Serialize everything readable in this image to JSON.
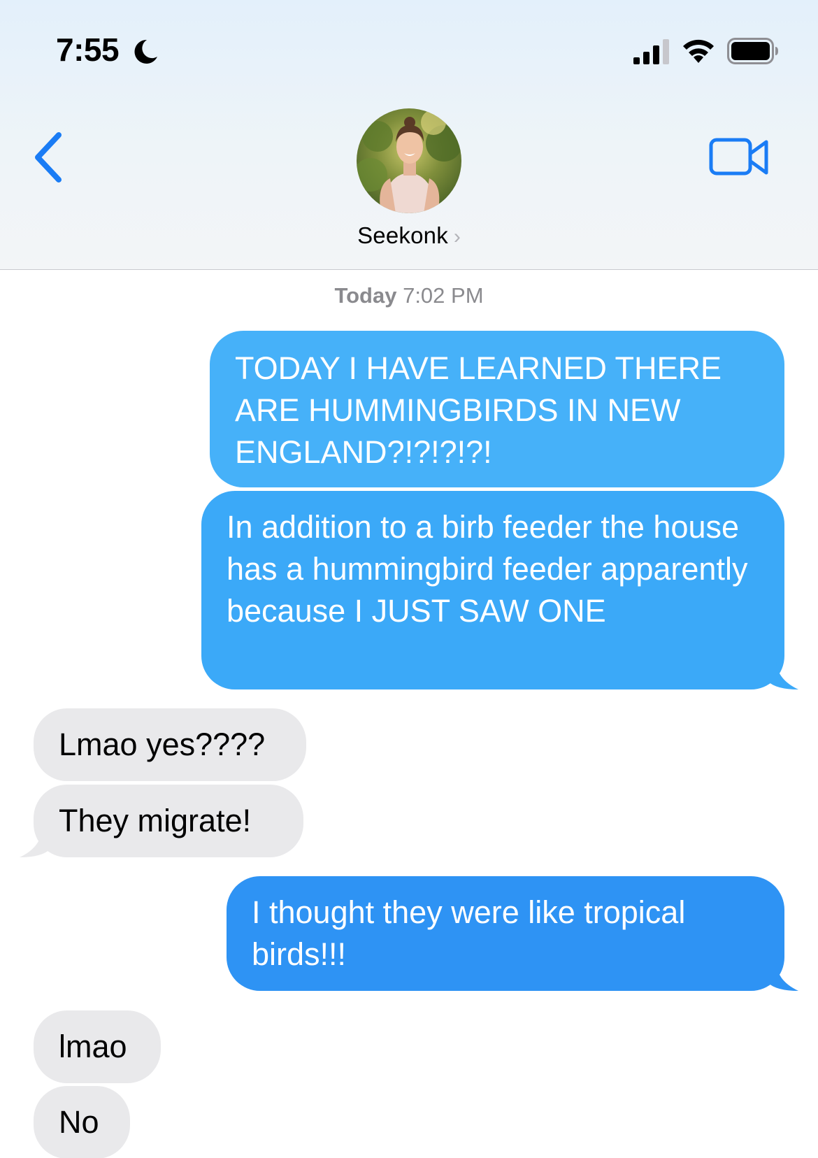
{
  "status_bar": {
    "time": "7:55",
    "focus_icon": "moon-icon",
    "signal_icon": "cellular-signal-icon",
    "wifi_icon": "wifi-icon",
    "battery_icon": "battery-icon"
  },
  "header": {
    "back_icon": "chevron-left-icon",
    "contact_name": "Seekonk",
    "contact_chevron": "›",
    "video_icon": "video-camera-icon",
    "accent_color": "#1a7cf5"
  },
  "conversation": {
    "timestamp_day": "Today",
    "timestamp_time": "7:02 PM",
    "messages": [
      {
        "direction": "sent",
        "text": "TODAY I HAVE LEARNED THERE ARE HUMMINGBIRDS IN NEW ENGLAND?!?!?!?!"
      },
      {
        "direction": "sent",
        "text": "In addition to a birb feeder the house has a hummingbird feeder apparently because I JUST SAW ONE"
      },
      {
        "direction": "received",
        "text": "Lmao yes????"
      },
      {
        "direction": "received",
        "text": "They migrate!"
      },
      {
        "direction": "sent",
        "text": "I thought they were like tropical birds!!!"
      },
      {
        "direction": "received",
        "text": "lmao"
      },
      {
        "direction": "received",
        "text": "No"
      }
    ],
    "sent_color": "#2f97f5",
    "received_color": "#e9e9eb"
  }
}
